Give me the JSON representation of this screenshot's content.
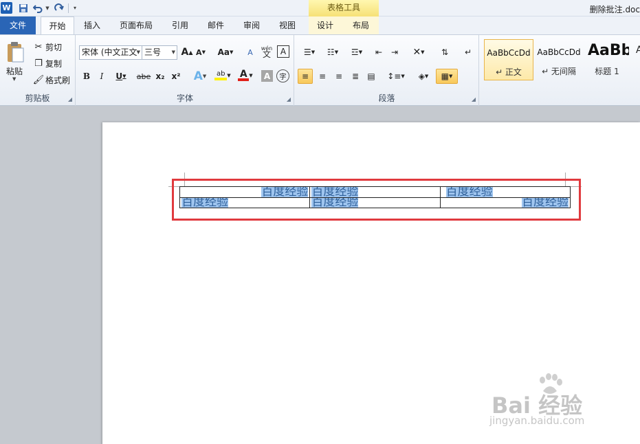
{
  "app": {
    "word_icon": "W",
    "doc_title": "删除批注.doc",
    "context_title": "表格工具"
  },
  "qat": [
    "save-icon",
    "undo-icon",
    "redo-icon",
    "customize-icon"
  ],
  "tabs": [
    {
      "label": "文件"
    },
    {
      "label": "开始"
    },
    {
      "label": "插入"
    },
    {
      "label": "页面布局"
    },
    {
      "label": "引用"
    },
    {
      "label": "邮件"
    },
    {
      "label": "审阅"
    },
    {
      "label": "视图"
    },
    {
      "label": "设计"
    },
    {
      "label": "布局"
    }
  ],
  "ribbon": {
    "clipboard": {
      "label": "剪贴板",
      "paste": "粘贴",
      "cut": "剪切",
      "copy": "复制",
      "format_painter": "格式刷"
    },
    "font": {
      "label": "字体",
      "font_name": "宋体 (中文正文",
      "font_size": "三号",
      "bold": "B",
      "italic": "I",
      "underline": "U",
      "strike": "abe",
      "sub": "x₂",
      "sup": "x²",
      "change_case": "Aa",
      "grow": "A",
      "shrink": "A",
      "clear": "A",
      "phonetic": "wén",
      "char_border": "A",
      "char_shade": "A",
      "enclose": "字"
    },
    "paragraph": {
      "label": "段落"
    },
    "styles": {
      "items": [
        {
          "sample": "AaBbCcDd",
          "name": "↵ 正文"
        },
        {
          "sample": "AaBbCcDd",
          "name": "↵ 无间隔"
        },
        {
          "sample": "AaBb",
          "name": "标题 1"
        }
      ]
    }
  },
  "document": {
    "table": {
      "rows": [
        [
          "百度经验",
          "百度经验",
          "百度经验"
        ],
        [
          "百度经验",
          "百度经验",
          "百度经验"
        ]
      ]
    }
  },
  "watermark": {
    "brand": "Bai 经验",
    "url": "jingyan.baidu.com"
  },
  "colors": {
    "file_tab": "#2a65b6",
    "context_tab": "#f6e074",
    "selection": "#9fc5ef",
    "annotation_box": "#e03a3e"
  }
}
